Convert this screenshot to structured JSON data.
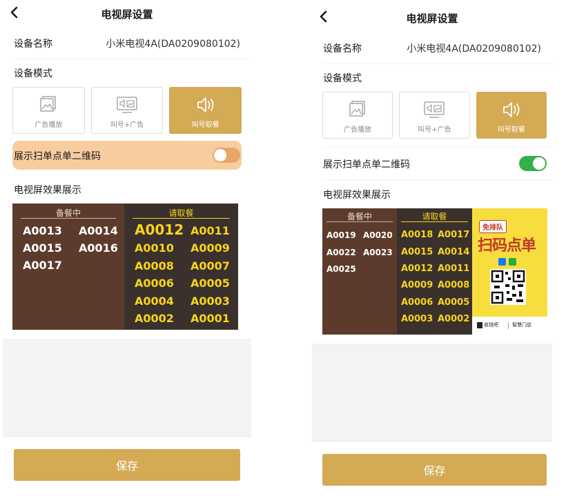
{
  "left": {
    "title": "电视屏设置",
    "device_name_label": "设备名称",
    "device_name_value": "小米电视4A(DA0209080102)",
    "device_mode_label": "设备模式",
    "modes": [
      {
        "label": "广告播放",
        "icon": "image-icon"
      },
      {
        "label": "叫号+广告",
        "icon": "tv-speaker-image-icon"
      },
      {
        "label": "叫号取餐",
        "icon": "speaker-icon"
      }
    ],
    "active_mode_index": 2,
    "qr_toggle_label": "展示扫单点单二维码",
    "qr_toggle_on": false,
    "preview_label": "电视屏效果展示",
    "preparing_header": "备餐中",
    "pickup_header": "请取餐",
    "preparing": [
      "A0013",
      "A0014",
      "A0015",
      "A0016",
      "A0017"
    ],
    "pickup_big": "A0012",
    "pickup": [
      "A0011",
      "A0010",
      "A0009",
      "A0008",
      "A0007",
      "A0006",
      "A0005",
      "A0004",
      "A0003",
      "A0002",
      "A0001"
    ],
    "save_label": "保存"
  },
  "right": {
    "title": "电视屏设置",
    "device_name_label": "设备名称",
    "device_name_value": "小米电视4A(DA0209080102)",
    "device_mode_label": "设备模式",
    "modes": [
      {
        "label": "广告播放",
        "icon": "image-icon"
      },
      {
        "label": "叫号+广告",
        "icon": "tv-speaker-image-icon"
      },
      {
        "label": "叫号取餐",
        "icon": "speaker-icon"
      }
    ],
    "active_mode_index": 2,
    "qr_toggle_label": "展示扫单点单二维码",
    "qr_toggle_on": true,
    "preview_label": "电视屏效果展示",
    "preparing_header": "备餐中",
    "pickup_header": "请取餐",
    "preparing": [
      "A0019",
      "A0020",
      "A0022",
      "A0023",
      "A0025"
    ],
    "pickup": [
      "A0018",
      "A0017",
      "A0015",
      "A0014",
      "A0012",
      "A0011",
      "A0009",
      "A0008",
      "A0006",
      "A0005",
      "A0003",
      "A0002"
    ],
    "qr_panel": {
      "badge": "免排队",
      "headline": "扫码点单",
      "brand_left": "收钱吧",
      "brand_right": "智慧门店"
    },
    "save_label": "保存"
  },
  "colors": {
    "accent": "#d4aa55",
    "highlight_row": "#f7cda0",
    "toggle_off": "#e9a566",
    "toggle_on": "#34b04a",
    "preparing_bg": "#5d3b2c",
    "pickup_bg": "#3a302c",
    "pickup_text": "#f7d41d"
  }
}
